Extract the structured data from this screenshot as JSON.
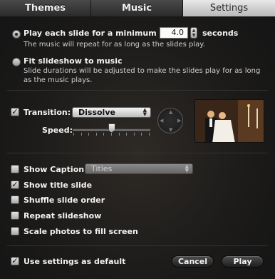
{
  "tabs": [
    {
      "label": "Themes",
      "active": false
    },
    {
      "label": "Music",
      "active": false
    },
    {
      "label": "Settings",
      "active": true
    }
  ],
  "duration": {
    "option_label": "Play each slide for a minimum of",
    "value": "4.0",
    "unit": "seconds",
    "selected": true,
    "description": "The music will repeat for as long as the slides play."
  },
  "fit_music": {
    "option_label": "Fit slideshow to music",
    "selected": false,
    "description": "Slide durations will be adjusted to make the slides play for as long as the music plays."
  },
  "transition": {
    "label": "Transition:",
    "checked": true,
    "value": "Dissolve",
    "speed_label": "Speed:",
    "speed_level": 0.5
  },
  "caption": {
    "label": "Show Caption:",
    "checked": false,
    "value": "Titles"
  },
  "options": {
    "show_title_slide": {
      "label": "Show title slide",
      "checked": true
    },
    "shuffle": {
      "label": "Shuffle slide order",
      "checked": false
    },
    "repeat": {
      "label": "Repeat slideshow",
      "checked": false
    },
    "scale": {
      "label": "Scale photos to fill screen",
      "checked": false
    }
  },
  "footer": {
    "default_label": "Use settings as default",
    "default_checked": true,
    "cancel_label": "Cancel",
    "play_label": "Play"
  },
  "icons": {
    "check": "✓",
    "stepper": "updown-arrows-icon",
    "popup_arrows": "updown-chevron-icon",
    "dpad": "direction-pad-icon",
    "preview": "wedding-photo-thumbnail"
  }
}
